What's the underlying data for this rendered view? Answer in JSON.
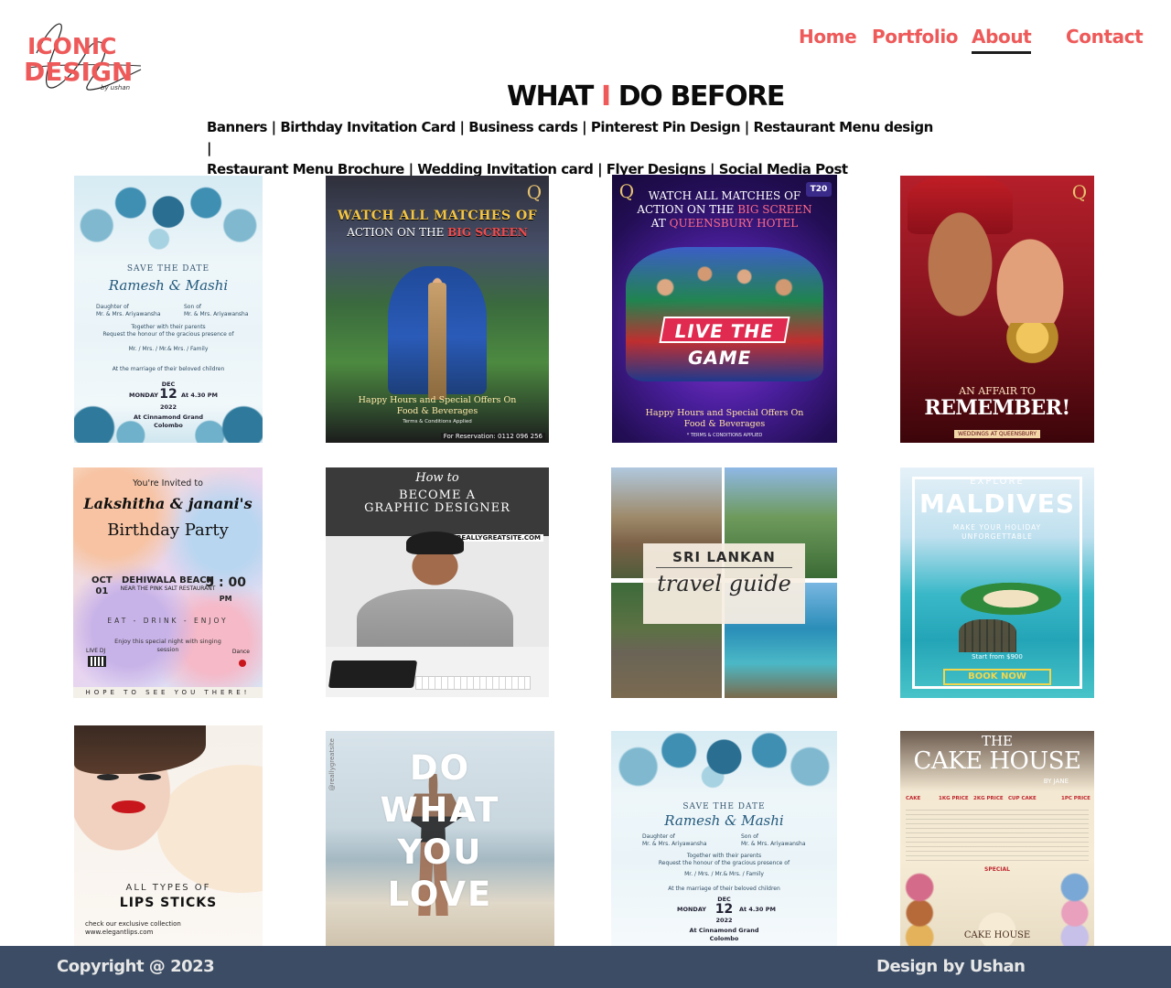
{
  "brand": {
    "logo_line1": "ICONIC",
    "logo_line2": "DESIGN",
    "logo_by": "by ushan",
    "accent_color": "#ee5a5a"
  },
  "nav": {
    "items": [
      {
        "label": "Home",
        "active": false
      },
      {
        "label": "Portfolio",
        "active": false
      },
      {
        "label": "About",
        "active": true
      },
      {
        "label": "Contact",
        "active": false
      }
    ]
  },
  "heading": {
    "part1": "WHAT",
    "accent": "I",
    "part2": "DO BEFORE"
  },
  "categories": {
    "line1": "Banners | Birthday Invitation Card | Business cards | Pinterest Pin Design | Restaurant Menu design |",
    "line2": "Restaurant Menu Brochure | Wedding Invitation card | Flyer Designs | Social Media Post"
  },
  "gallery": {
    "wedding": {
      "save": "SAVE THE DATE",
      "names": "Ramesh  &  Mashi",
      "daughter": "Daughter of",
      "daughter_parents": "Mr. & Mrs. Ariyawansha",
      "son": "Son of",
      "son_parents": "Mr. & Mrs. Ariyawansha",
      "together": "Together with their parents",
      "request": "Request the honour of the gracious presence of",
      "guests": "Mr. / Mrs. / Mr.& Mrs. / Family",
      "marriage": "At the marriage of their beloved children",
      "month": "DEC",
      "weekday": "MONDAY",
      "day": "12",
      "time": "At 4.30 PM",
      "year": "2022",
      "venue": "At Cinnamond Grand",
      "city": "Colombo"
    },
    "cricket1": {
      "line1": "WATCH ALL MATCHES OF",
      "line2a": "ACTION ON THE",
      "line2b": "BIG SCREEN",
      "foot1": "Happy Hours and Special Offers On",
      "foot2": "Food & Beverages",
      "terms": "Terms & Conditions Applied",
      "reservation": "For Reservation: 0112 096 256"
    },
    "cricket2": {
      "line1": "WATCH ALL MATCHES OF",
      "line2a": "ACTION ON THE",
      "line2b": "BIG SCREEN",
      "line3a": "AT",
      "line3b": "QUEENSBURY HOTEL",
      "live": "LIVE THE GAME",
      "foot1": "Happy Hours and Special Offers On",
      "foot2": "Food & Beverages",
      "terms": "* TERMS & CONDITIONS APPLIED",
      "badge": "T20"
    },
    "couple": {
      "line1": "AN AFFAIR TO",
      "line2": "REMEMBER!",
      "line3": "WEDDINGS AT QUEENSBURY",
      "logo": "Q"
    },
    "birthday": {
      "invited": "You're Invited to",
      "names": "Lakshitha & janani's",
      "party": "Birthday Party",
      "month": "OCT",
      "day": "01",
      "place": "DEHIWALA BEACH",
      "place_sub": "NEAR THE PINK SALT RESTAURANT",
      "time": "5 : 00",
      "ampm": "PM",
      "eat": "EAT - DRINK - ENJOY",
      "enjoy": "Enjoy this special night with singing session",
      "live": "LIVE DJ",
      "dance": "Dance",
      "hope": "HOPE TO SEE YOU THERE!"
    },
    "designer": {
      "howto": "How to",
      "line1": "BECOME A",
      "line2": "GRAPHIC DESIGNER",
      "site": "REALLYGREATSITE.COM"
    },
    "srilanka": {
      "line1": "SRI LANKAN",
      "line2": "travel guide"
    },
    "maldives": {
      "explore": "EXPLORE",
      "title": "MALDIVES",
      "sub1": "MAKE YOUR HOLIDAY",
      "sub2": "UNFORGETTABLE",
      "price": "Start from $900",
      "cta": "BOOK NOW"
    },
    "lipstick": {
      "line1": "ALL TYPES OF",
      "line2": "LIPS STICKS",
      "check": "check our exclusive collection",
      "site": "www.elegantlips.com"
    },
    "dwyl": {
      "w1": "DO",
      "w2": "WHAT",
      "w3": "YOU",
      "w4": "LOVE",
      "tag": "@reallygreatsite"
    },
    "cake": {
      "the": "THE",
      "name": "CAKE HOUSE",
      "by": "BY JANE",
      "col1": "CAKE",
      "col2": "1KG PRICE",
      "col3": "2KG PRICE",
      "col4": "CUP CAKE",
      "col5": "1PC PRICE",
      "special": "SPECIAL",
      "mini": "CAKE HOUSE"
    }
  },
  "footer": {
    "copyright": "Copyright @ 2023",
    "credit": "Design by Ushan",
    "bg_color": "#3b4c64"
  }
}
